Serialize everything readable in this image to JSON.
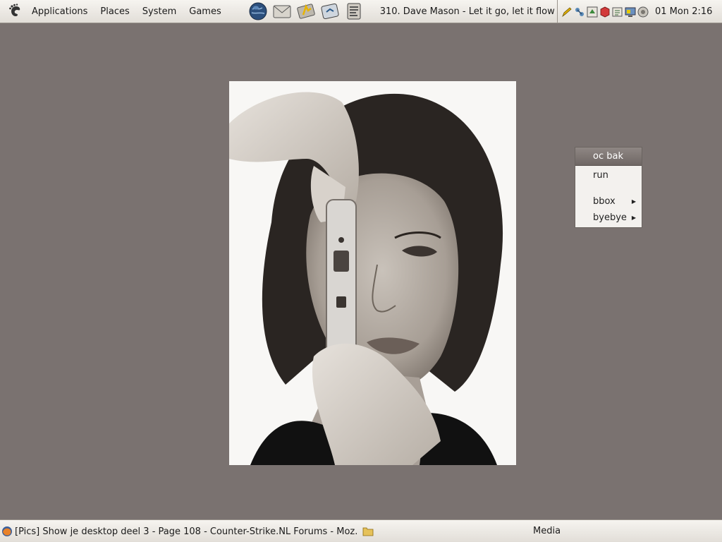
{
  "top_panel": {
    "menus": [
      "Applications",
      "Places",
      "System",
      "Games"
    ],
    "launchers": [
      "web-browser-icon",
      "mail-icon",
      "music-player-icon",
      "chat-icon",
      "text-editor-icon"
    ],
    "now_playing": "310. Dave Mason - Let it go, let it flow",
    "tray_icons": [
      "pencil-icon",
      "network-icon",
      "update-icon",
      "package-icon",
      "notes-icon",
      "monitor-icon",
      "volume-icon"
    ],
    "clock": "01 Mon 2:16"
  },
  "desktop_menu": {
    "title": "oc bak",
    "items": [
      {
        "label": "run",
        "submenu": false
      },
      {
        "label": "bbox",
        "submenu": true
      },
      {
        "label": "byebye",
        "submenu": true
      }
    ]
  },
  "bottom_panel": {
    "task": "[Pics] Show je desktop deel 3 - Page 108 - Counter-Strike.NL Forums - Moz...",
    "task_icon": "firefox-icon",
    "folder_icon": "folder-icon",
    "media_label": "Media"
  },
  "colors": {
    "desktop_bg": "#7a7270",
    "panel_bg": "#ece9e4",
    "menu_title_bg": "#7f7774"
  }
}
